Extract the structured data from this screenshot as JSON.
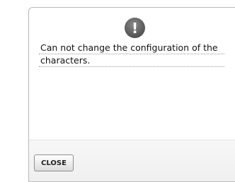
{
  "dialog": {
    "icon": "exclamation-icon",
    "icon_glyph": "!",
    "message_lines": [
      "Can not change the configuration of the",
      "characters."
    ],
    "close_label": "CLOSE"
  }
}
